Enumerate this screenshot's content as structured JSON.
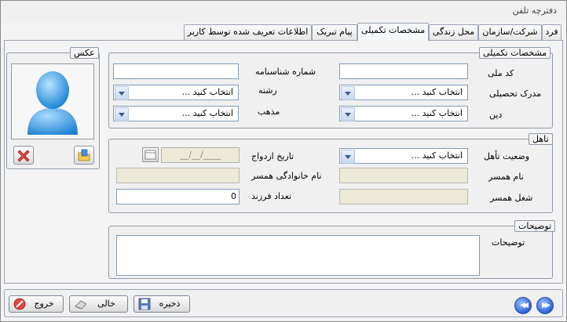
{
  "window": {
    "title": "دفترچه تلفن"
  },
  "tabs": [
    {
      "label": "فرد"
    },
    {
      "label": "شرکت/سازمان"
    },
    {
      "label": "محل زندگی"
    },
    {
      "label": "مشخصات تکمیلی"
    },
    {
      "label": "پیام تبریک"
    },
    {
      "label": "اطلاعات تعریف شده توسط کاربر"
    }
  ],
  "photo": {
    "title": "عکس"
  },
  "details": {
    "title": "مشخصات تکمیلی",
    "national_code_label": "کد ملی",
    "national_code_value": "",
    "id_number_label": "شماره شناسنامه",
    "id_number_value": "",
    "education_label": "مدرک تحصیلی",
    "education_value": "انتخاب کنید ...",
    "field_label": "رشته",
    "field_value": "انتخاب کنید ...",
    "religion_label": "دین",
    "religion_value": "انتخاب کنید ...",
    "sect_label": "مذهب",
    "sect_value": "انتخاب کنید ..."
  },
  "marriage": {
    "title": "تاهل",
    "status_label": "وضعیت تأهل",
    "status_value": "انتخاب کنید ...",
    "date_label": "تاریخ ازدواج",
    "date_value": "__/__/____",
    "spouse_name_label": "نام همسر",
    "spouse_name_value": "",
    "spouse_family_label": "نام خانوادگی همسر",
    "spouse_family_value": "",
    "spouse_job_label": "شغل همسر",
    "spouse_job_value": "",
    "children_label": "تعداد فرزند",
    "children_value": "0"
  },
  "notes": {
    "title": "توضیحات",
    "label": "توضیحات",
    "value": ""
  },
  "footer": {
    "exit_label": "خروج",
    "clear_label": "خالی",
    "save_label": "ذخیره"
  },
  "colors": {
    "accent": "#2d63d8",
    "avatar": "#3fa3e6",
    "delete": "#e0483f"
  }
}
